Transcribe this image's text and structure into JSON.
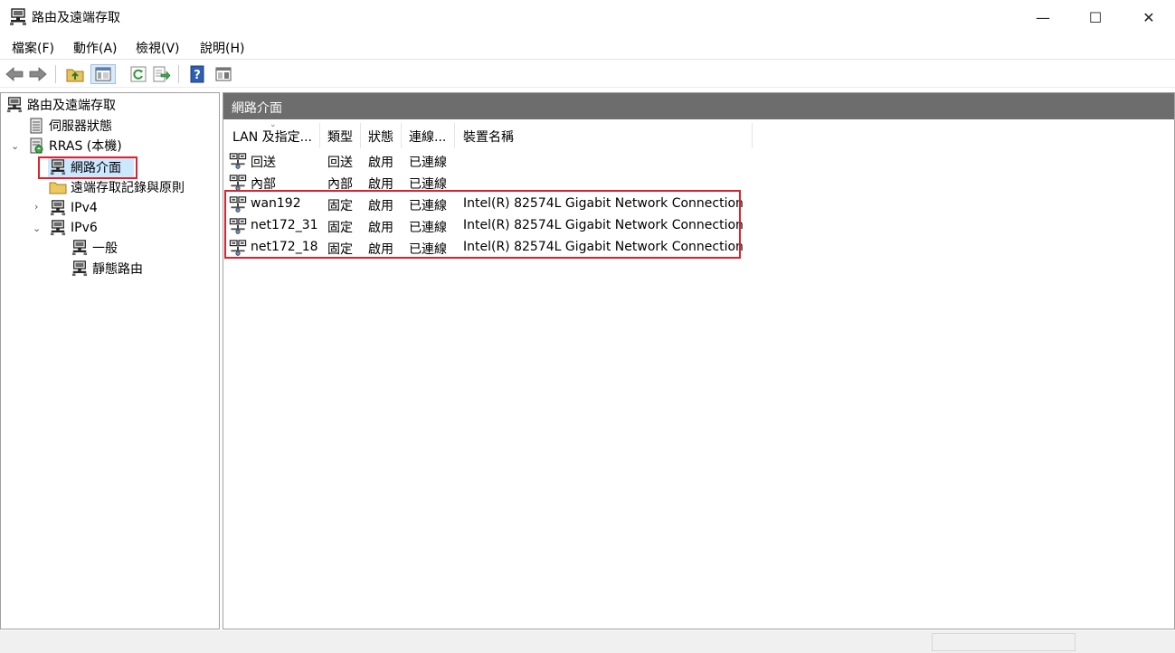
{
  "window": {
    "title": "路由及遠端存取",
    "minimize": "—",
    "maximize": "☐",
    "close": "✕"
  },
  "menu": [
    "檔案(F)",
    "動作(A)",
    "檢視(V)",
    "說明(H)"
  ],
  "toolbar": {
    "icons": [
      "back-arrow-icon",
      "forward-arrow-icon",
      "up-folder-icon",
      "show-hide-tree-icon",
      "refresh-icon",
      "export-list-icon",
      "help-icon",
      "console-view-icon"
    ]
  },
  "tree": {
    "root": "路由及遠端存取",
    "server_status": "伺服器狀態",
    "server": "RRAS (本機)",
    "network_interfaces": "網路介面",
    "remote_logging": "遠端存取記錄與原則",
    "ipv4": "IPv4",
    "ipv6": "IPv6",
    "general": "一般",
    "static_routes": "靜態路由"
  },
  "main": {
    "header": "網路介面",
    "columns": [
      "LAN 及指定...",
      "類型",
      "狀態",
      "連線...",
      "裝置名稱"
    ],
    "rows": [
      {
        "name": "回送",
        "type": "回送",
        "status": "啟用",
        "connection": "已連線",
        "device": ""
      },
      {
        "name": "內部",
        "type": "內部",
        "status": "啟用",
        "connection": "已連線",
        "device": ""
      },
      {
        "name": "wan192",
        "type": "固定",
        "status": "啟用",
        "connection": "已連線",
        "device": "Intel(R) 82574L Gigabit Network Connection"
      },
      {
        "name": "net172_31",
        "type": "固定",
        "status": "啟用",
        "connection": "已連線",
        "device": "Intel(R) 82574L Gigabit Network Connection"
      },
      {
        "name": "net172_18",
        "type": "固定",
        "status": "啟用",
        "connection": "已連線",
        "device": "Intel(R) 82574L Gigabit Network Connection"
      }
    ]
  },
  "colors": {
    "highlight": "#e0202a",
    "header_bg": "#6d6d6d",
    "selection": "#cce8ff"
  }
}
